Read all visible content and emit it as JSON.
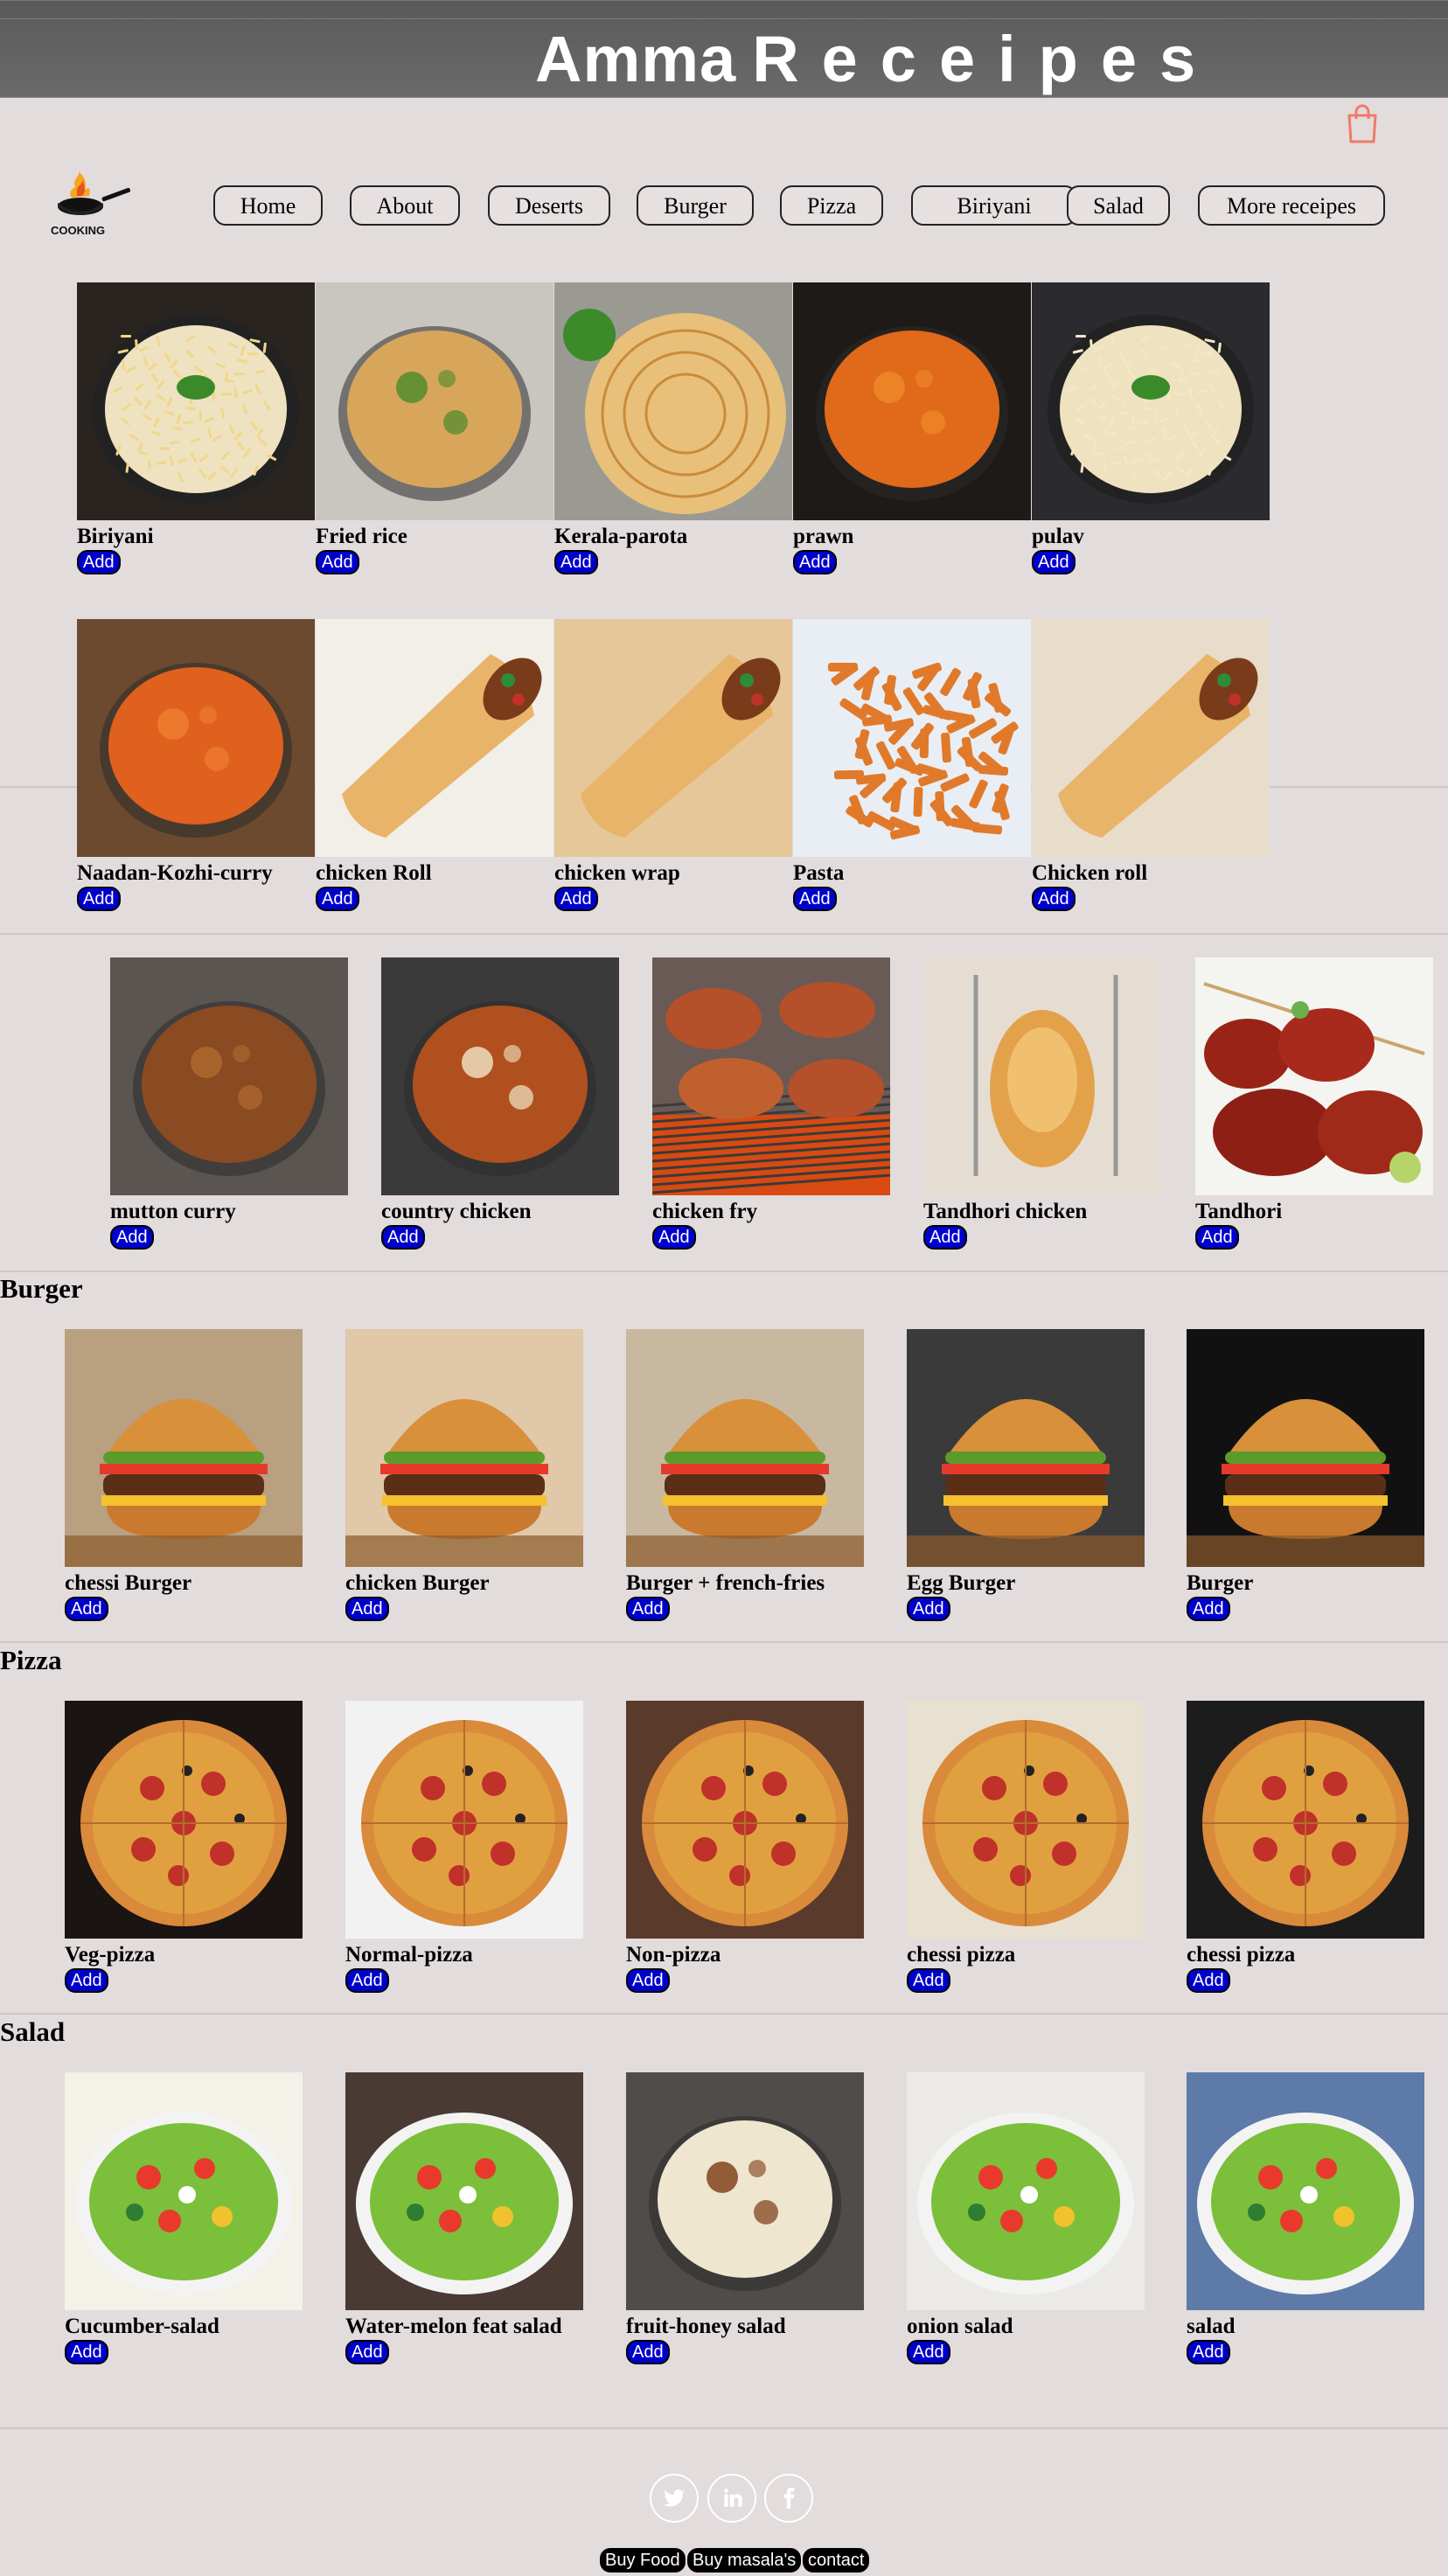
{
  "header": {
    "title_word1": "Amma",
    "title_word2": "Receipes"
  },
  "logo": {
    "text": "COOKING"
  },
  "nav": [
    "Home",
    "About",
    "Deserts",
    "Burger",
    "Pizza",
    "Biriyani",
    "Salad",
    "More receipes"
  ],
  "add_label": "Add",
  "row1": [
    "Biriyani",
    "Fried rice",
    "Kerala-parota",
    "prawn",
    "pulav"
  ],
  "row2": [
    "Naadan-Kozhi-curry",
    "chicken Roll",
    "chicken wrap",
    "Pasta",
    "Chicken roll"
  ],
  "row3": [
    "mutton curry",
    "country chicken",
    "chicken fry",
    "Tandhori chicken",
    "Tandhori"
  ],
  "burger": {
    "title": "Burger",
    "items": [
      "chessi Burger",
      "chicken Burger",
      "Burger + french-fries",
      "Egg Burger",
      "Burger"
    ]
  },
  "pizza": {
    "title": "Pizza",
    "items": [
      "Veg-pizza",
      "Normal-pizza",
      "Non-pizza",
      "chessi pizza",
      "chessi pizza"
    ]
  },
  "salad": {
    "title": "Salad",
    "items": [
      "Cucumber-salad",
      "Water-melon feat salad",
      "fruit-honey salad",
      "onion salad",
      "salad"
    ]
  },
  "footer": {
    "buttons": [
      "Buy Food",
      "Buy masala's",
      "contact"
    ]
  },
  "colors": {
    "header_bg": "#5a5a5a",
    "page_bg": "#e3dcdc",
    "add_bg": "#0000cc",
    "cart": "#f07a6a"
  },
  "icons": [
    "cart-icon",
    "logo-pan-icon",
    "twitter-icon",
    "linkedin-icon",
    "facebook-icon"
  ]
}
